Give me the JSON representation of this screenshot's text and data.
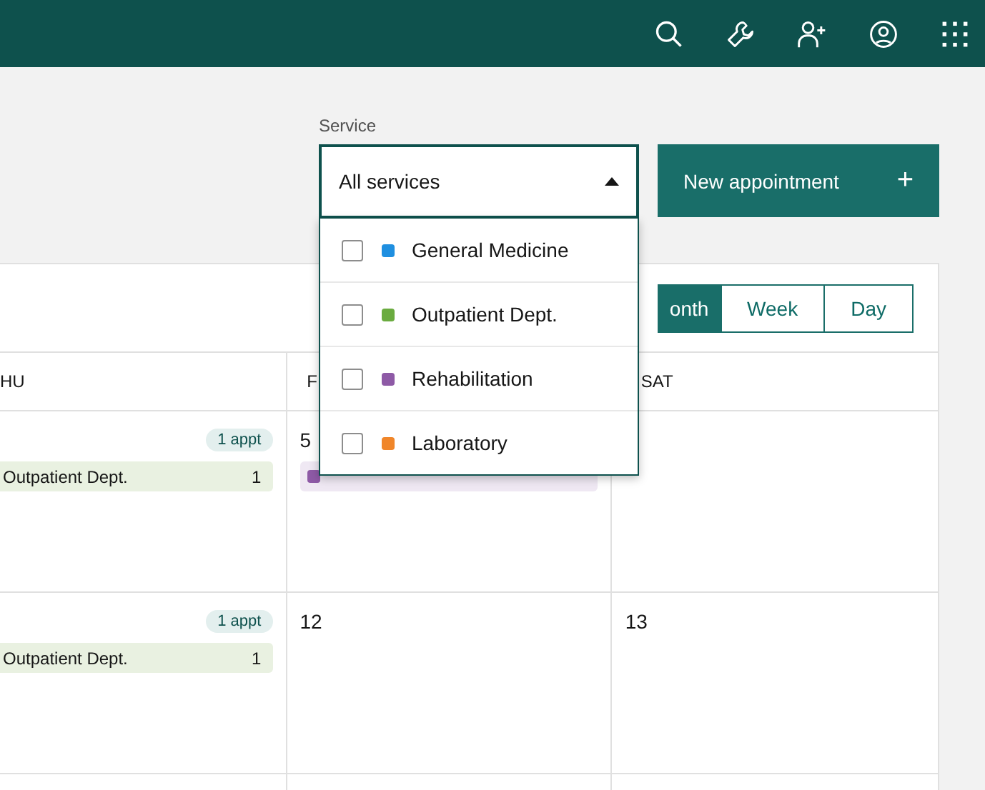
{
  "service_filter": {
    "label": "Service",
    "value": "All services",
    "expanded": true,
    "options": [
      {
        "label": "General Medicine",
        "color": "#1f8fe0",
        "checked": false
      },
      {
        "label": "Outpatient Dept.",
        "color": "#6aab3f",
        "checked": false
      },
      {
        "label": "Rehabilitation",
        "color": "#8e5aa6",
        "checked": false
      },
      {
        "label": "Laboratory",
        "color": "#f0862a",
        "checked": false
      }
    ]
  },
  "new_appointment_button": {
    "label": "New appointment",
    "icon": "+"
  },
  "view_switcher": [
    {
      "label": "onth",
      "selected": true
    },
    {
      "label": "Week",
      "selected": false
    },
    {
      "label": "Day",
      "selected": false
    }
  ],
  "calendar": {
    "columns": [
      "HU",
      "F",
      "SAT"
    ],
    "weeks": [
      {
        "days": [
          {
            "badge": "1 appt",
            "chips": [
              {
                "kind": "cut",
                "label": "Outpatient Dept.",
                "count": "1",
                "color": "#e9f1e1"
              }
            ]
          },
          {
            "date": "5",
            "chips": [
              {
                "kind": "covered",
                "color": "#8e5aa6"
              }
            ]
          }
        ]
      },
      {
        "days": [
          {
            "badge": "1 appt",
            "chips": [
              {
                "kind": "cut",
                "label": "Outpatient Dept.",
                "count": "1",
                "color": "#e9f1e1"
              }
            ]
          },
          {
            "date": "12"
          },
          {
            "date": "13"
          }
        ]
      }
    ]
  }
}
